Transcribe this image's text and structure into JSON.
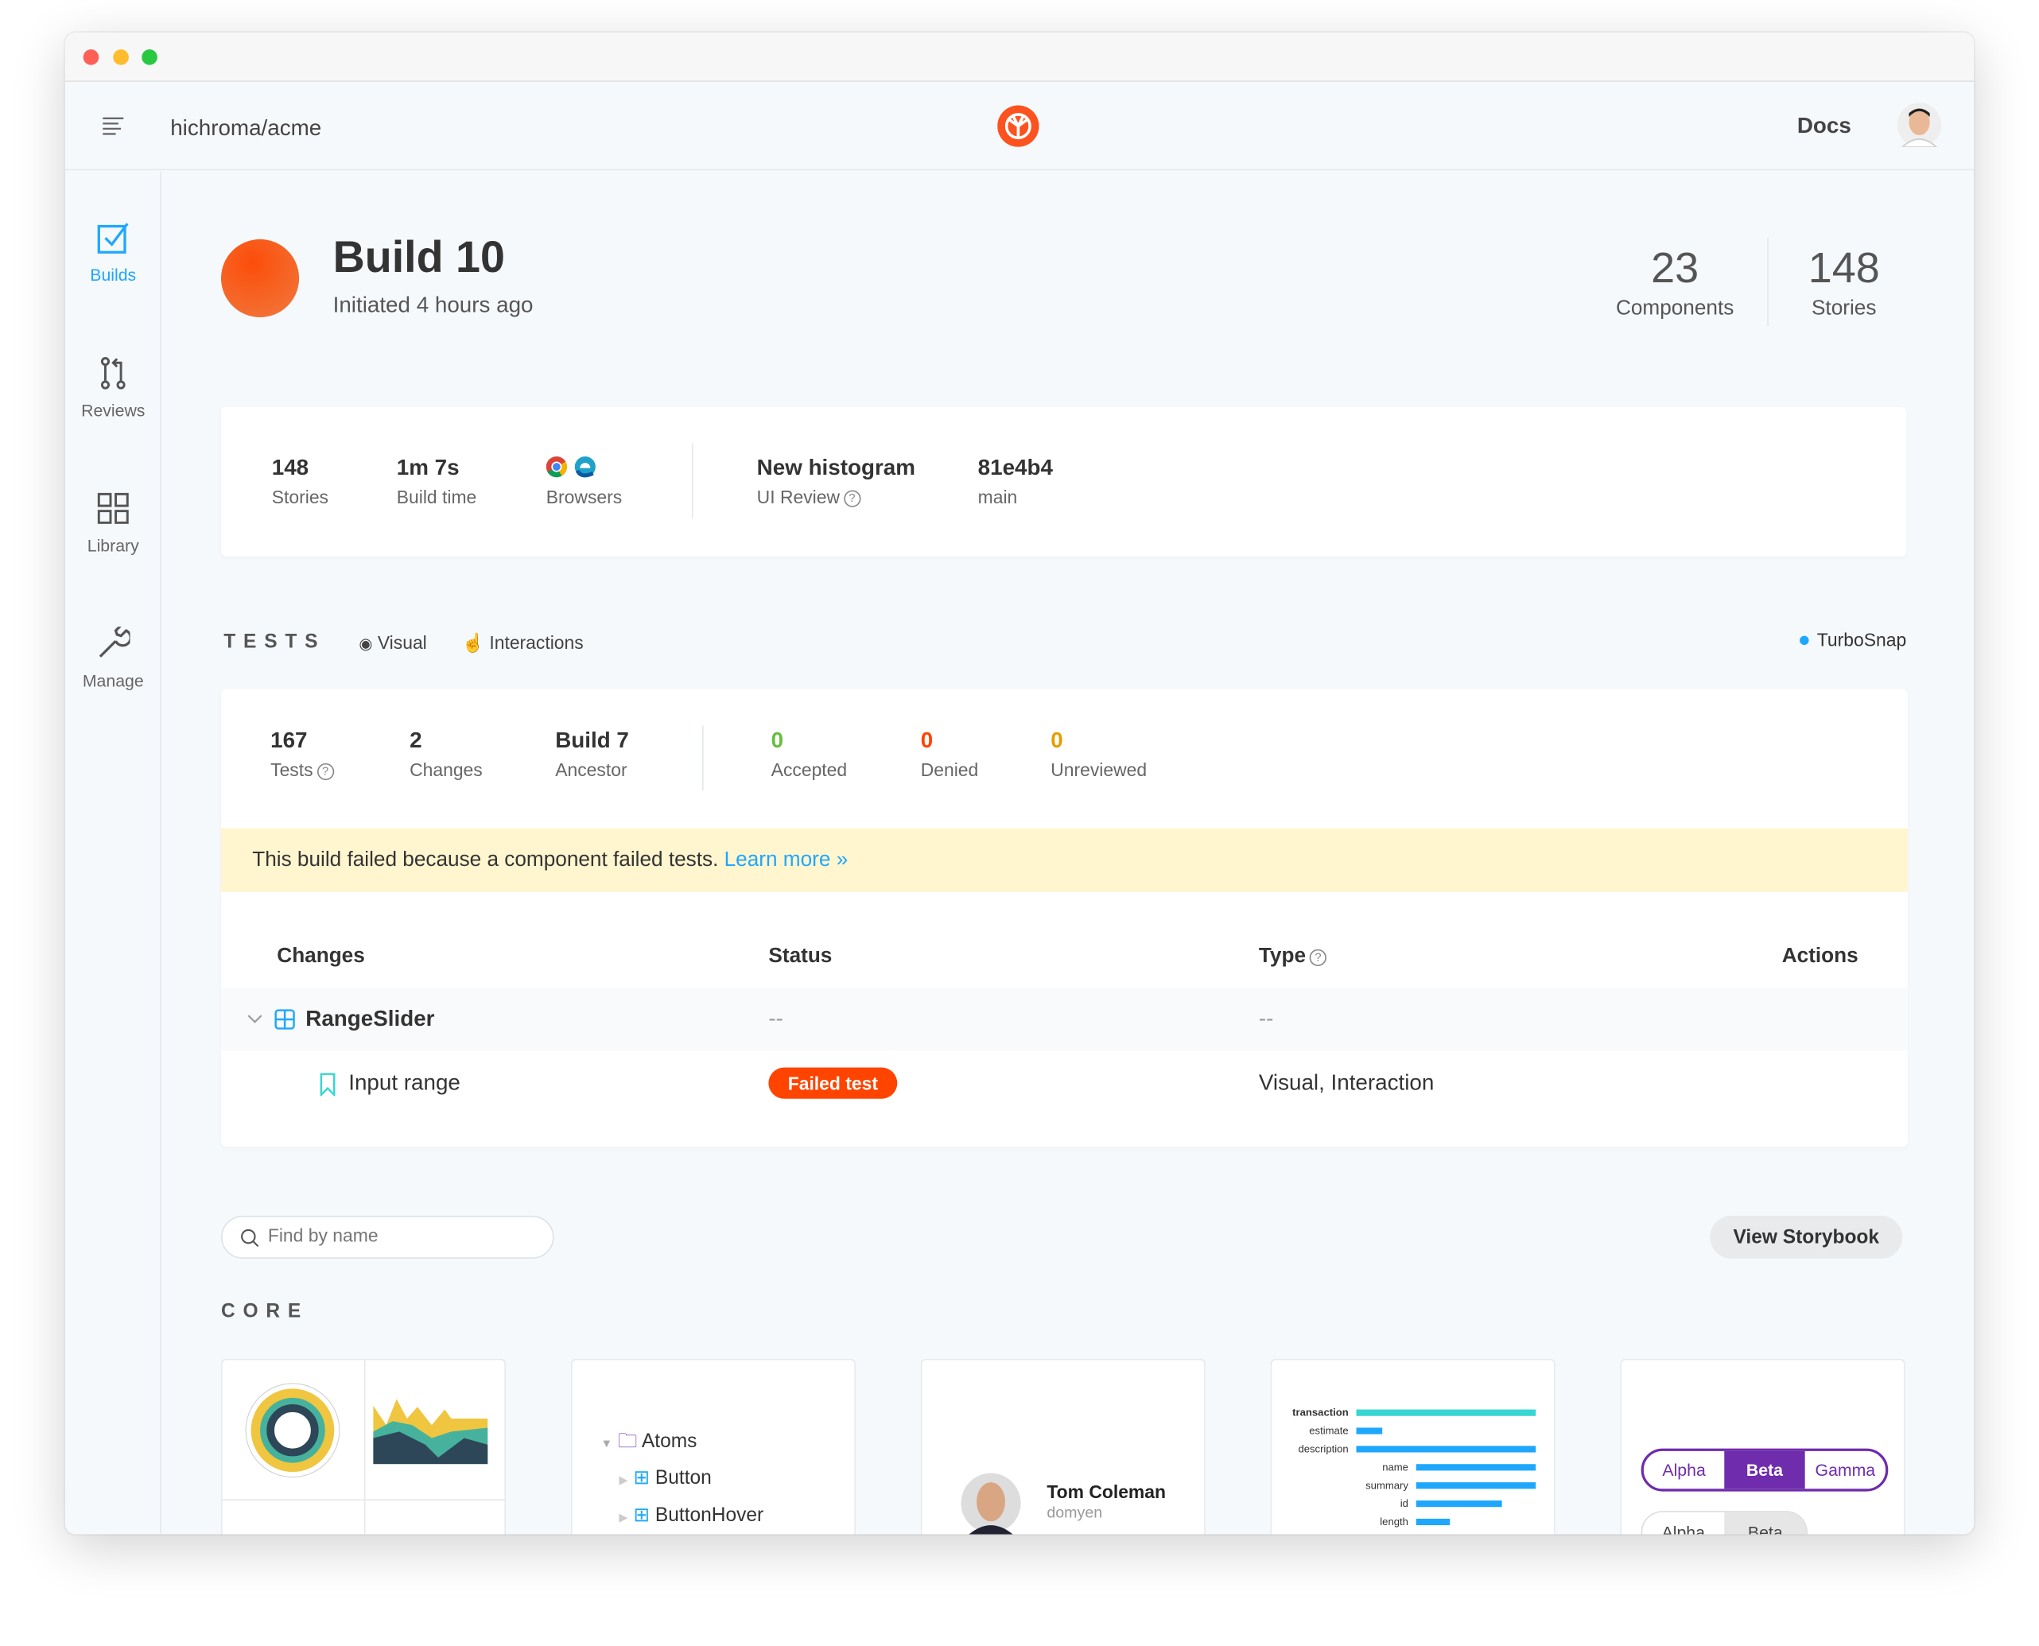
{
  "header": {
    "repo": "hichroma/acme",
    "docs_label": "Docs",
    "brand_color": "#fc521f"
  },
  "sidebar": {
    "items": [
      {
        "label": "Builds",
        "icon": "checkbox-icon",
        "active": true
      },
      {
        "label": "Reviews",
        "icon": "pull-request-icon"
      },
      {
        "label": "Library",
        "icon": "grid-icon"
      },
      {
        "label": "Manage",
        "icon": "wrench-icon"
      }
    ]
  },
  "build": {
    "title": "Build 10",
    "subtitle": "Initiated 4 hours ago",
    "status_color": "#fc521f",
    "components_count": "23",
    "components_label": "Components",
    "stories_count": "148",
    "stories_label": "Stories"
  },
  "summary": {
    "stories_value": "148",
    "stories_label": "Stories",
    "build_time_value": "1m 7s",
    "build_time_label": "Build time",
    "browsers_label": "Browsers",
    "browsers": [
      "chrome-icon",
      "edge-icon"
    ],
    "review_value": "New histogram",
    "review_label": "UI Review",
    "branch_commit": "81e4b4",
    "branch_label": "main"
  },
  "tests": {
    "heading": "TESTS",
    "visual_label": "Visual",
    "interactions_label": "Interactions",
    "turbosnap_label": "TurboSnap",
    "tests_value": "167",
    "tests_label": "Tests",
    "changes_value": "2",
    "changes_label": "Changes",
    "ancestor_value": "Build 7",
    "ancestor_label": "Ancestor",
    "accepted_value": "0",
    "accepted_label": "Accepted",
    "denied_value": "0",
    "denied_label": "Denied",
    "unreviewed_value": "0",
    "unreviewed_label": "Unreviewed",
    "colors": {
      "accepted": "#66bf3c",
      "denied": "#ff4400",
      "unreviewed": "#e69d00"
    },
    "banner_text": "This build failed because a component failed tests.",
    "banner_link": "Learn more »",
    "table": {
      "columns": [
        "Changes",
        "Status",
        "Type",
        "Actions"
      ],
      "rows": [
        {
          "name": "RangeSlider",
          "status": "--",
          "type": "--"
        },
        {
          "name": "Input range",
          "status": "Failed test",
          "type": "Visual, Interaction"
        }
      ]
    }
  },
  "library": {
    "search_placeholder": "Find by name",
    "view_storybook_label": "View Storybook",
    "section_title": "CORE",
    "tree": [
      "Atoms",
      "Button",
      "ButtonHover"
    ],
    "avatar_name": "Tom Coleman",
    "avatar_user": "domyen",
    "bars": [
      "transaction",
      "estimate",
      "description",
      "name",
      "summary",
      "id",
      "length"
    ],
    "button_group": [
      "Alpha",
      "Beta",
      "Gamma"
    ],
    "button_group2": [
      "Alpha",
      "Beta"
    ]
  }
}
